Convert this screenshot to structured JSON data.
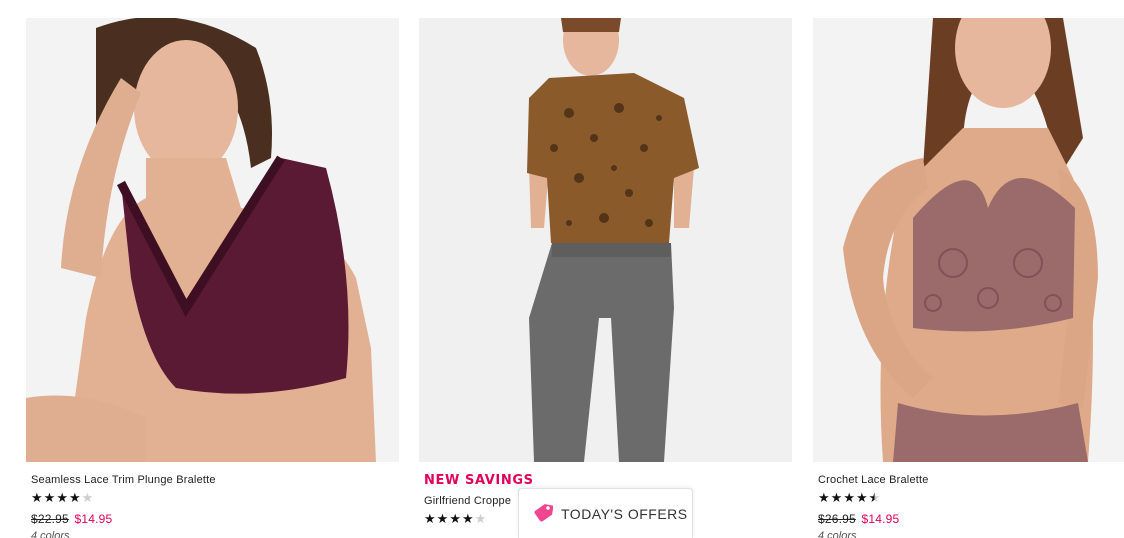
{
  "products": [
    {
      "badge": "",
      "name": "Seamless Lace Trim Plunge Bralette",
      "rating_stars": 4,
      "old_price": "$22.95",
      "price": "$14.95",
      "colors": "4 colors",
      "image_alt": "model wearing burgundy lace bralette"
    },
    {
      "badge": "NEW SAVINGS",
      "name": "Girlfriend Croppe",
      "rating_stars": 4,
      "old_price": "",
      "price": "",
      "colors": "",
      "image_alt": "model wearing leopard crop tee and grey joggers"
    },
    {
      "badge": "",
      "name": "Crochet Lace Bralette",
      "rating_stars": 4.5,
      "old_price": "$26.95",
      "price": "$14.95",
      "colors": "4 colors",
      "image_alt": "model wearing mauve crochet lace bralette"
    }
  ],
  "offers_button": {
    "label": "TODAY'S OFFERS",
    "icon": "tag-icon"
  },
  "colors": {
    "sale_pink": "#e0005b",
    "star_fill": "#111111",
    "star_empty": "#cfcfcf"
  }
}
